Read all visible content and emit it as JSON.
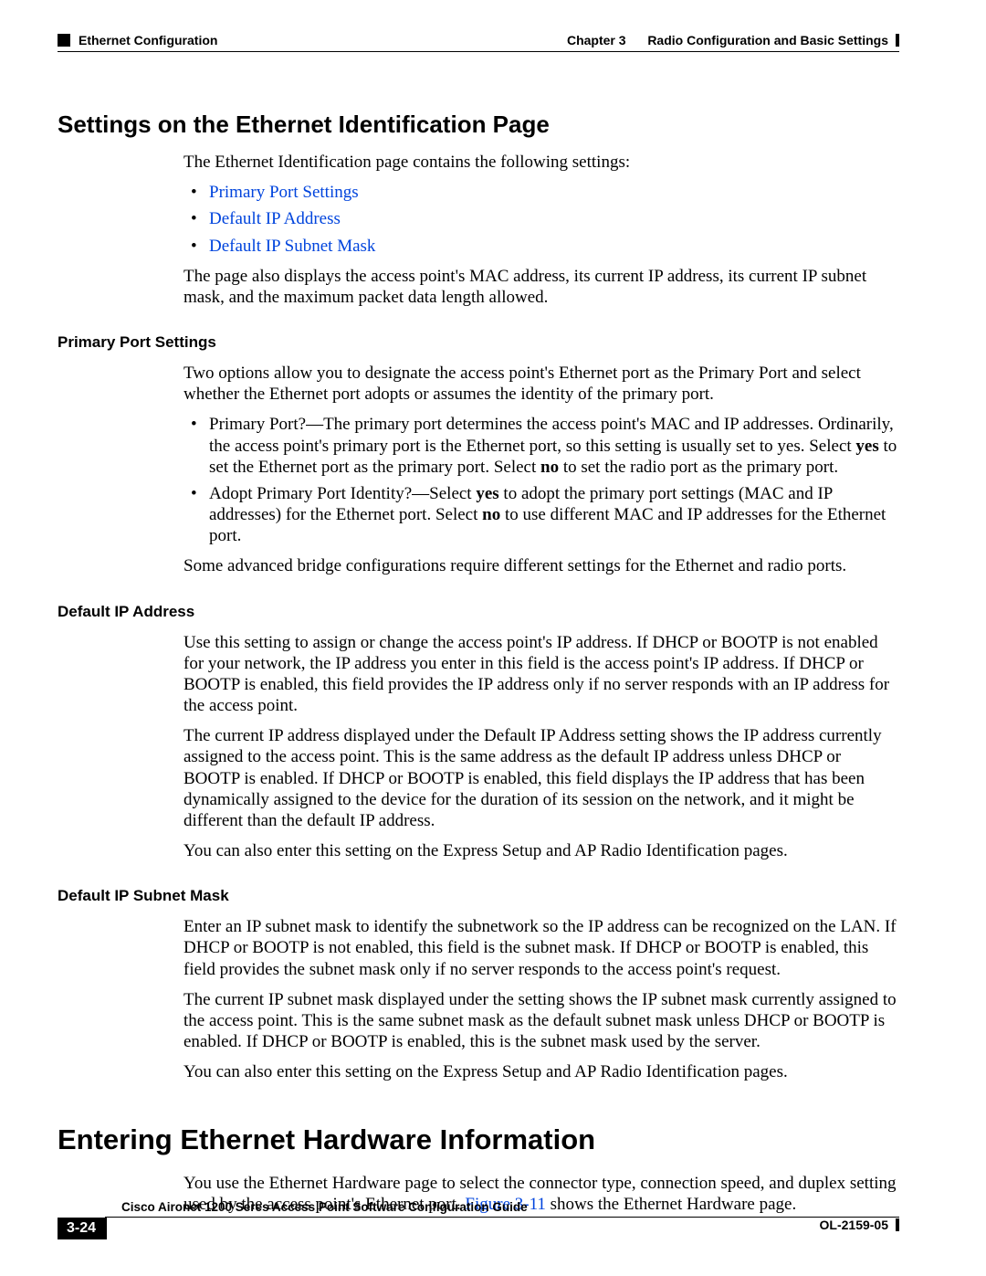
{
  "header": {
    "section": "Ethernet Configuration",
    "chapterLabel": "Chapter 3",
    "chapterTitle": "Radio Configuration and Basic Settings"
  },
  "h2_1": "Settings on the Ethernet Identification Page",
  "intro_p1": "The Ethernet Identification page contains the following settings:",
  "intro_bullets": {
    "b1": "Primary Port Settings",
    "b2": "Default IP Address",
    "b3": "Default IP Subnet Mask"
  },
  "intro_p2": "The page also displays the access point's MAC address, its current IP address, its current IP subnet mask, and the maximum packet data length allowed.",
  "pps": {
    "heading": "Primary Port Settings",
    "p1": "Two options allow you to designate the access point's Ethernet port as the Primary Port and select whether the Ethernet port adopts or assumes the identity of the primary port.",
    "li1_a": "Primary Port?—The primary port determines the access point's MAC and IP addresses. Ordinarily, the access point's primary port is the Ethernet port, so this setting is usually set to yes. Select ",
    "li1_yes": "yes",
    "li1_b": " to set the Ethernet port as the primary port. Select ",
    "li1_no": "no",
    "li1_c": " to set the radio port as the primary port.",
    "li2_a": "Adopt Primary Port Identity?—Select ",
    "li2_yes": "yes",
    "li2_b": " to adopt the primary port settings (MAC and IP addresses) for the Ethernet port. Select ",
    "li2_no": "no",
    "li2_c": " to use different MAC and IP addresses for the Ethernet port.",
    "p2": "Some advanced bridge configurations require different settings for the Ethernet and radio ports."
  },
  "dip": {
    "heading": "Default IP Address",
    "p1": "Use this setting to assign or change the access point's IP address. If DHCP or BOOTP is not enabled for your network, the IP address you enter in this field is the access point's IP address. If DHCP or BOOTP is enabled, this field provides the IP address only if no server responds with an IP address for the access point.",
    "p2": "The current IP address displayed under the Default IP Address setting shows the IP address currently assigned to the access point. This is the same address as the default IP address unless DHCP or BOOTP is enabled. If DHCP or BOOTP is enabled, this field displays the IP address that has been dynamically assigned to the device for the duration of its session on the network, and it might be different than the default IP address.",
    "p3": "You can also enter this setting on the Express Setup and AP Radio Identification pages."
  },
  "dsm": {
    "heading": "Default IP Subnet Mask",
    "p1": "Enter an IP subnet mask to identify the subnetwork so the IP address can be recognized on the LAN. If DHCP or BOOTP is not enabled, this field is the subnet mask. If DHCP or BOOTP is enabled, this field provides the subnet mask only if no server responds to the access point's request.",
    "p2": "The current IP subnet mask displayed under the setting shows the IP subnet mask currently assigned to the access point. This is the same subnet mask as the default subnet mask unless DHCP or BOOTP is enabled. If DHCP or BOOTP is enabled, this is the subnet mask used by the server.",
    "p3": "You can also enter this setting on the Express Setup and AP Radio Identification pages."
  },
  "h1_1": "Entering Ethernet Hardware Information",
  "ehw": {
    "p1_a": "You use the Ethernet Hardware page to select the connector type, connection speed, and duplex setting used by the access point's Ethernet port. ",
    "p1_link": "Figure 3-11",
    "p1_b": " shows the Ethernet Hardware page."
  },
  "footer": {
    "guide": "Cisco Aironet 1200 Seres Access Point Software Configuration Guide",
    "page": "3-24",
    "doc": "OL-2159-05"
  }
}
